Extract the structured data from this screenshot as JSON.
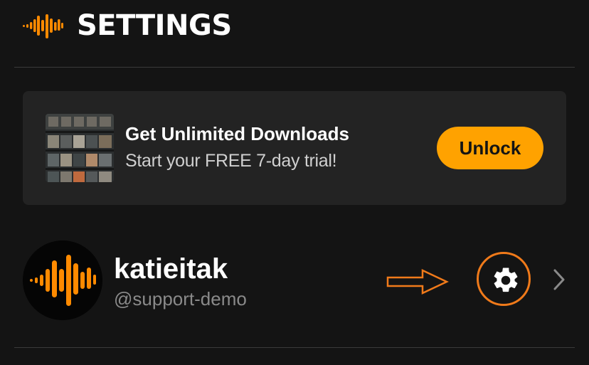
{
  "header": {
    "title": "SETTINGS",
    "logo_icon": "audiomack-waveform-icon",
    "accent_color": "#ffa200"
  },
  "promo": {
    "title": "Get Unlimited Downloads",
    "subtitle": "Start your FREE 7-day trial!",
    "button_label": "Unlock",
    "thumbnail_icon": "album-collage-image",
    "button_color": "#ffa200"
  },
  "profile": {
    "username": "katieitak",
    "handle": "@support-demo",
    "avatar_icon": "audiomack-logo-avatar",
    "settings_icon": "gear-icon",
    "chevron_icon": "chevron-right-icon",
    "highlight_color": "#f07a1a"
  }
}
